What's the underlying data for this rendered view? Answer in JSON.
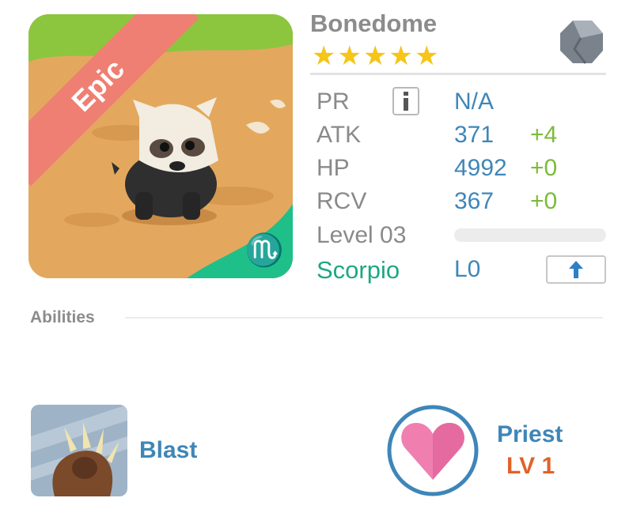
{
  "portrait": {
    "rarity": "Epic",
    "zodiac_symbol": "♏"
  },
  "monster": {
    "name": "Bonedome",
    "star_count": 5,
    "star_symbol": "★"
  },
  "stats": [
    {
      "label": "PR",
      "value": "N/A",
      "bonus": ""
    },
    {
      "label": "ATK",
      "value": "371",
      "bonus": "+4"
    },
    {
      "label": "HP",
      "value": "4992",
      "bonus": "+0"
    },
    {
      "label": "RCV",
      "value": "367",
      "bonus": "+0"
    }
  ],
  "level": {
    "label": "Level 03",
    "progress": 0
  },
  "zodiac": {
    "name": "Scorpio",
    "rank": "L0"
  },
  "abilities": {
    "title": "Abilities",
    "skill_name": "Blast",
    "class_name": "Priest",
    "class_level": "LV 1"
  },
  "colors": {
    "stat_value": "#3f86b8",
    "stat_bonus": "#7cbb3a",
    "zodiac": "#1ea783",
    "class_level": "#e0622a",
    "rarity_ribbon": "#ef7f72"
  }
}
